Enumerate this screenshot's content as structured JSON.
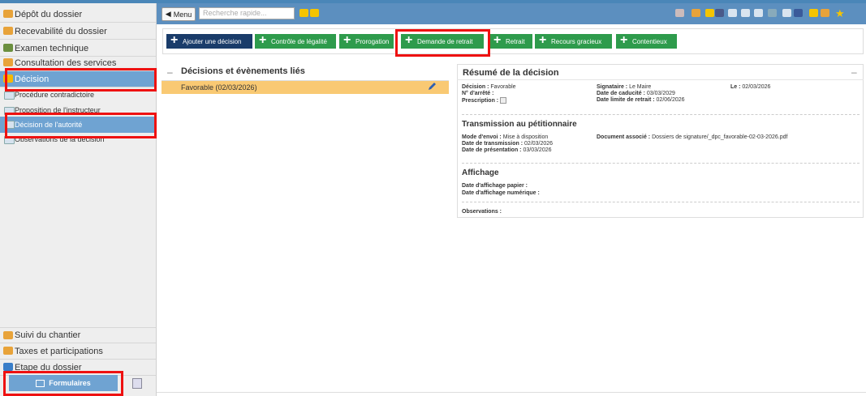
{
  "sidebar": {
    "items": [
      {
        "label": "Dépôt du dossier",
        "icon": "folder-add-icon",
        "color": "#e8a33a"
      },
      {
        "label": "Recevabilité du dossier",
        "icon": "folder-check-icon",
        "color": "#e8a33a"
      },
      {
        "label": "Examen technique",
        "icon": "folder-gear-icon",
        "color": "#6b8f3f"
      },
      {
        "label": "Consultation des services",
        "icon": "users-icon",
        "color": "#e8a33a"
      },
      {
        "label": "Décision",
        "icon": "thumbs-up-icon",
        "color": "#f5b800"
      }
    ],
    "subitems": [
      {
        "label": "Procédure contradictoire"
      },
      {
        "label": "Proposition de l'instructeur"
      },
      {
        "label": "Décision de l'autorité"
      },
      {
        "label": "Observations de la décision"
      }
    ],
    "bottom_items": [
      {
        "label": "Suivi du chantier",
        "icon": "worker-icon",
        "color": "#e8a33a"
      },
      {
        "label": "Taxes et participations",
        "icon": "coins-icon",
        "color": "#e8a33a"
      },
      {
        "label": "Etape du dossier",
        "icon": "steps-icon",
        "color": "#3a7ec8"
      }
    ],
    "formulaires_label": "Formulaires"
  },
  "toolbar": {
    "menu_label": "Menu",
    "search_placeholder": "Recherche rapide..."
  },
  "actions": [
    {
      "label": "Ajouter une décision",
      "style": "navy"
    },
    {
      "label": "Contrôle de légalité",
      "style": "green"
    },
    {
      "label": "Prorogation",
      "style": "green"
    },
    {
      "label": "Demande de retrait",
      "style": "green"
    },
    {
      "label": "Retrait",
      "style": "green"
    },
    {
      "label": "Recours gracieux",
      "style": "green"
    },
    {
      "label": "Contentieux",
      "style": "green"
    }
  ],
  "left_panel": {
    "title": "Décisions et évènements liés",
    "rows": [
      {
        "label": "Favorable (02/03/2026)"
      }
    ]
  },
  "summary": {
    "title": "Résumé de la décision",
    "decision_label": "Décision :",
    "decision_value": "Favorable",
    "arrete_label": "N° d'arrêté :",
    "arrete_value": "",
    "prescription_label": "Prescription :",
    "signataire_label": "Signataire :",
    "signataire_value": "Le Maire",
    "caducite_label": "Date de caducité :",
    "caducite_value": "03/03/2029",
    "limite_label": "Date limite de retrait :",
    "limite_value": "02/06/2026",
    "le_label": "Le :",
    "le_value": "02/03/2026",
    "transmission_title": "Transmission au pétitionnaire",
    "envoi_label": "Mode d'envoi :",
    "envoi_value": "Mise à disposition",
    "transmission_label": "Date de transmission :",
    "transmission_value": "02/03/2026",
    "presentation_label": "Date de présentation :",
    "presentation_value": "03/03/2026",
    "document_label": "Document associé :",
    "document_value": "Dossiers de signature/_dpc_favorable-02-03-2026.pdf",
    "affichage_title": "Affichage",
    "papier_label": "Date d'affichage papier :",
    "numerique_label": "Date d'affichage numérique :",
    "observations_label": "Observations :"
  }
}
